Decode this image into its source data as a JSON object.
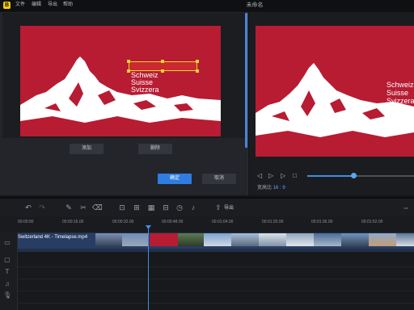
{
  "app": {
    "title": "未命名"
  },
  "menu": [
    "文件",
    "编辑",
    "导出",
    "帮助"
  ],
  "dialog": {
    "add_label": "添加",
    "delete_label": "删除",
    "confirm_label": "确定",
    "cancel_label": "取消"
  },
  "frame_text": [
    "Schweiz",
    "Suisse",
    "Svizzera"
  ],
  "preview": {
    "ratio_label": "宽高比",
    "ratio_value": "16 : 9",
    "progress": 0.44
  },
  "toolbar": {
    "export_label": "导出"
  },
  "timeline": {
    "ticks": [
      "00:00:00",
      "00:00:16.00",
      "00:00:32.00",
      "00:00:48.00",
      "00:01:04.00",
      "00:01:20.00",
      "00:01:36.00",
      "00:01:52.00"
    ],
    "clip_label": "Switzerland 4K - Timelapse.mp4"
  },
  "colors": {
    "accent": "#3d8ee8",
    "frame_red": "#b71c33",
    "selection": "#f2d32a"
  }
}
